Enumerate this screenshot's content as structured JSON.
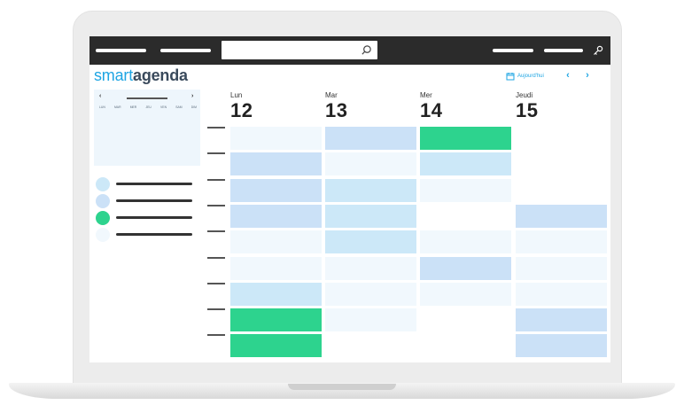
{
  "app": {
    "logo_part1": "smart",
    "logo_part2": "agenda"
  },
  "toolbar": {
    "today_label": "Aujourd'hui",
    "prev_icon": "chevron-left-icon",
    "next_icon": "chevron-right-icon",
    "search_icon": "search-icon",
    "settings_icon": "key-icon",
    "accent": "#1ea5e3"
  },
  "mini_calendar": {
    "prev_label": "‹",
    "next_label": "›",
    "weekdays": [
      "LUN",
      "MAR",
      "MER",
      "JEU",
      "VEN",
      "SAM",
      "DIM"
    ]
  },
  "legend": [
    {
      "color": "#cce8f8"
    },
    {
      "color": "#cbe1f7"
    },
    {
      "color": "#2dd38e"
    },
    {
      "color": "#f1f8fd"
    }
  ],
  "days": [
    {
      "name": "Lun",
      "number": "12"
    },
    {
      "name": "Mar",
      "number": "13"
    },
    {
      "name": "Mer",
      "number": "14"
    },
    {
      "name": "Jeudi",
      "number": "15"
    }
  ],
  "colors": {
    "green": "#2dd38e",
    "blue": "#cbe1f7",
    "cyan": "#cce8f8",
    "pale": "#f1f8fd"
  },
  "slots": [
    [
      "pale",
      "blue",
      "green",
      ""
    ],
    [
      "blue",
      "pale",
      "cyan",
      ""
    ],
    [
      "blue",
      "cyan",
      "pale",
      ""
    ],
    [
      "blue",
      "cyan",
      "",
      "blue"
    ],
    [
      "pale",
      "cyan",
      "pale",
      "pale"
    ],
    [
      "pale",
      "pale",
      "blue",
      "pale"
    ],
    [
      "cyan",
      "pale",
      "pale",
      "pale"
    ],
    [
      "green",
      "pale",
      "",
      "blue"
    ],
    [
      "green",
      "",
      "",
      "blue"
    ]
  ]
}
